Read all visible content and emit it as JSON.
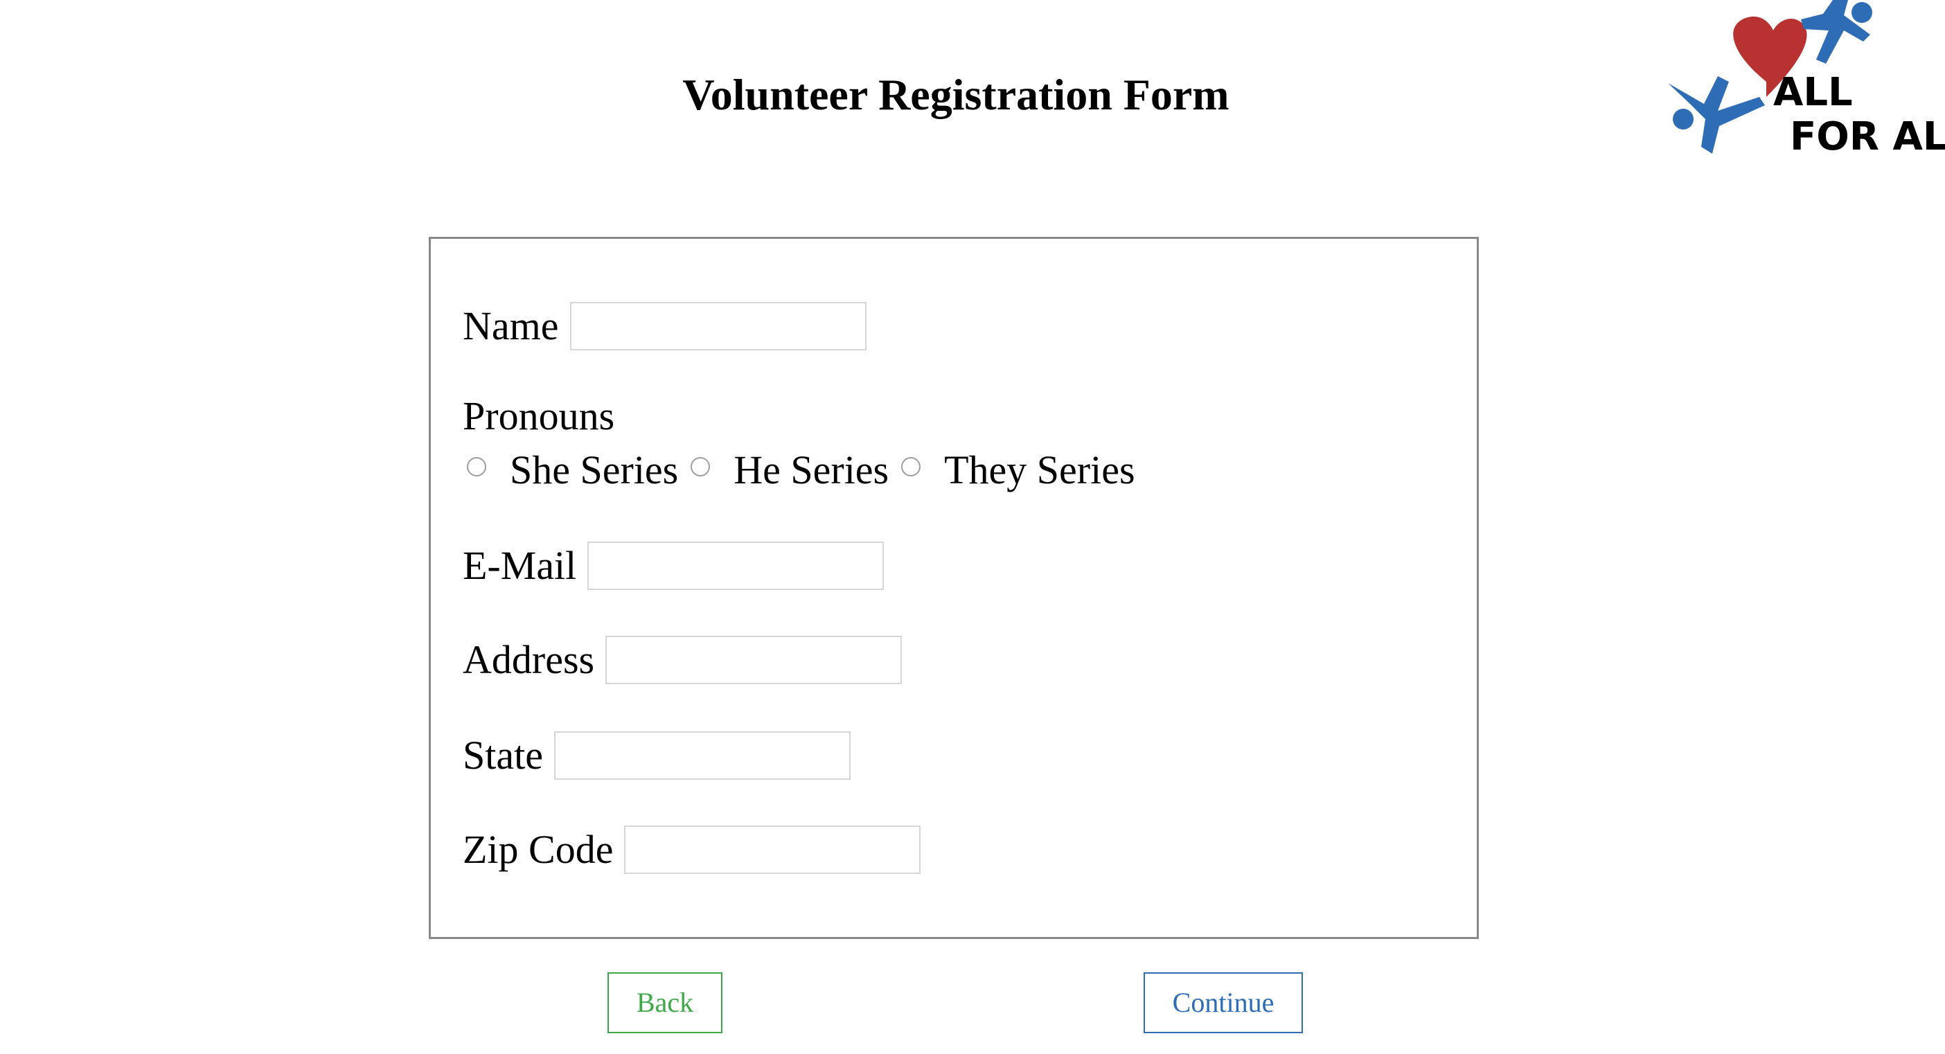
{
  "header": {
    "title": "Volunteer Registration Form"
  },
  "logo": {
    "line1": "ALL",
    "line2": "FOR ALL",
    "icon": "volunteer-heart-logo",
    "colors": {
      "figures": "#2e6cb5",
      "heart": "#b83232"
    }
  },
  "form": {
    "name_label": "Name",
    "name_value": "",
    "pronouns_label": "Pronouns",
    "pronoun_options": [
      {
        "label": "She Series",
        "checked": false
      },
      {
        "label": "He Series",
        "checked": false
      },
      {
        "label": "They Series",
        "checked": false
      }
    ],
    "email_label": "E-Mail",
    "email_value": "",
    "address_label": "Address",
    "address_value": "",
    "state_label": "State",
    "state_value": "",
    "zip_label": "Zip Code",
    "zip_value": ""
  },
  "actions": {
    "back_label": "Back",
    "continue_label": "Continue",
    "back_color": "#3fa94a",
    "continue_color": "#2e6cb5"
  }
}
